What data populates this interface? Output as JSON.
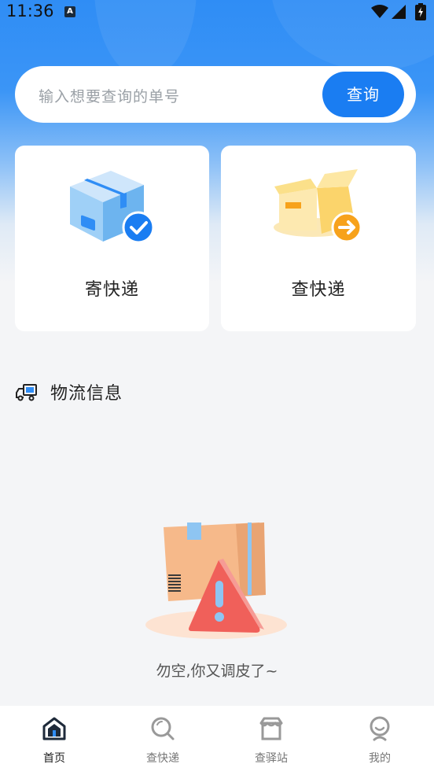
{
  "status_bar": {
    "time": "11:36",
    "notification_icon": "A"
  },
  "search": {
    "placeholder": "输入想要查询的单号",
    "button_label": "查询"
  },
  "cards": [
    {
      "label": "寄快递",
      "icon": "box-check-icon"
    },
    {
      "label": "查快递",
      "icon": "open-box-arrow-icon"
    }
  ],
  "logistics": {
    "title": "物流信息",
    "icon": "truck-icon"
  },
  "empty_state": {
    "message": "勿空,你又调皮了~",
    "icon": "box-warning-icon"
  },
  "tabbar": {
    "items": [
      {
        "label": "首页",
        "icon": "home-icon",
        "active": true
      },
      {
        "label": "查快递",
        "icon": "search-icon",
        "active": false
      },
      {
        "label": "查驿站",
        "icon": "store-icon",
        "active": false
      },
      {
        "label": "我的",
        "icon": "user-icon",
        "active": false
      }
    ]
  },
  "colors": {
    "primary": "#1a7df2",
    "accent_orange": "#f7a21b",
    "tab_active": "#1e2a3a"
  }
}
